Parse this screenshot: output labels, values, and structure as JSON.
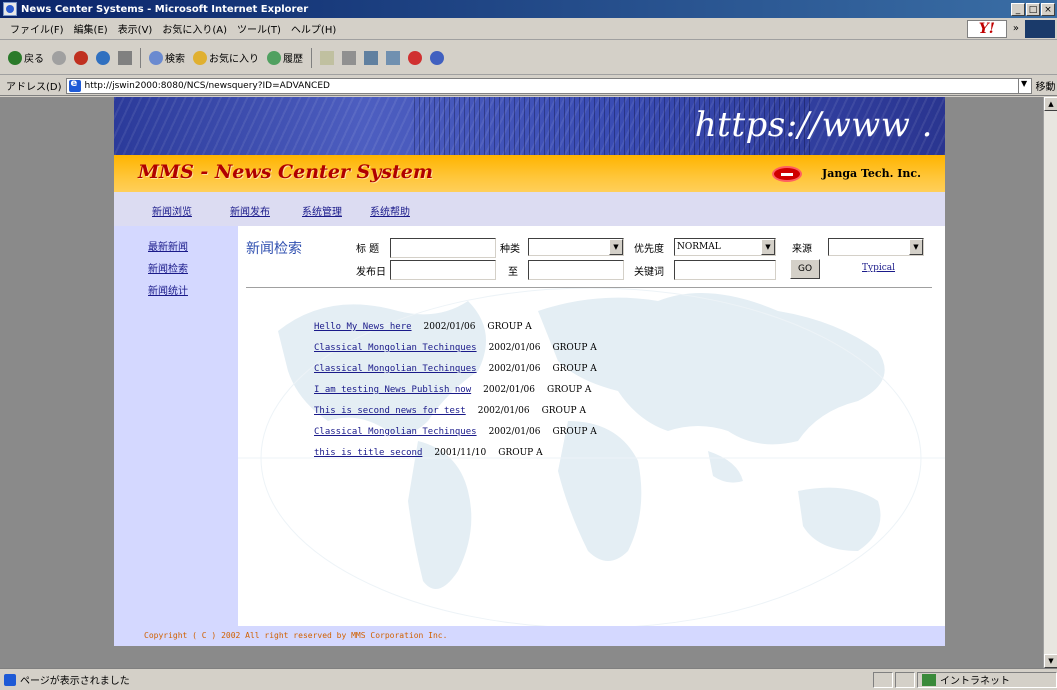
{
  "window": {
    "title": "News Center Systems - Microsoft Internet Explorer",
    "controls": [
      "_",
      "□",
      "×"
    ]
  },
  "menubar": {
    "items": [
      "ファイル(F)",
      "編集(E)",
      "表示(V)",
      "お気に入り(A)",
      "ツール(T)",
      "ヘルプ(H)"
    ],
    "more": "»"
  },
  "toolbar": {
    "back": "戻る",
    "search": "検索",
    "favorites": "お気に入り",
    "history": "履歴"
  },
  "addressbar": {
    "label": "アドレス(D)",
    "url": "http://jswin2000:8080/NCS/newsquery?ID=ADVANCED",
    "go": "移動"
  },
  "banner": {
    "https_text": "https://www ."
  },
  "header": {
    "system_name": "MMS - News Center System",
    "company": "Janga Tech. Inc."
  },
  "topnav": {
    "items": [
      "新闻浏览",
      "新闻发布",
      "系统管理",
      "系统帮助"
    ]
  },
  "leftnav": {
    "items": [
      "最新新闻",
      "新闻检索",
      "新闻统计"
    ]
  },
  "search": {
    "section_title": "新闻检索",
    "title_label": "标  题",
    "category_label": "种类",
    "priority_label": "优先度",
    "priority_value": "NORMAL",
    "source_label": "来源",
    "date_label": "发布日",
    "to_label": "至",
    "keyword_label": "关键词",
    "go_label": "GO",
    "typical_label": "Typical"
  },
  "news": [
    {
      "title": "Hello My News here",
      "date": "2002/01/06",
      "group": "GROUP A"
    },
    {
      "title": "Classical Mongolian Techinques",
      "date": "2002/01/06",
      "group": "GROUP A"
    },
    {
      "title": "Classical Mongolian Techinques",
      "date": "2002/01/06",
      "group": "GROUP A"
    },
    {
      "title": "I am testing News Publish now",
      "date": "2002/01/06",
      "group": "GROUP A"
    },
    {
      "title": "This is second news for test",
      "date": "2002/01/06",
      "group": "GROUP A"
    },
    {
      "title": "Classical Mongolian Techinques",
      "date": "2002/01/06",
      "group": "GROUP A"
    },
    {
      "title": "this is title second",
      "date": "2001/11/10",
      "group": "GROUP A"
    }
  ],
  "footer": {
    "copyright": "Copyright ( C ) 2002 All right reserved by MMS Corporation Inc."
  },
  "statusbar": {
    "text": "ページが表示されました",
    "zone": "イントラネット"
  },
  "colors": {
    "link": "#1a1a8a",
    "system_name": "#b00000",
    "header_strip": "#ffb400",
    "side_bg": "#d4d8ff",
    "footer_text": "#d06000"
  }
}
